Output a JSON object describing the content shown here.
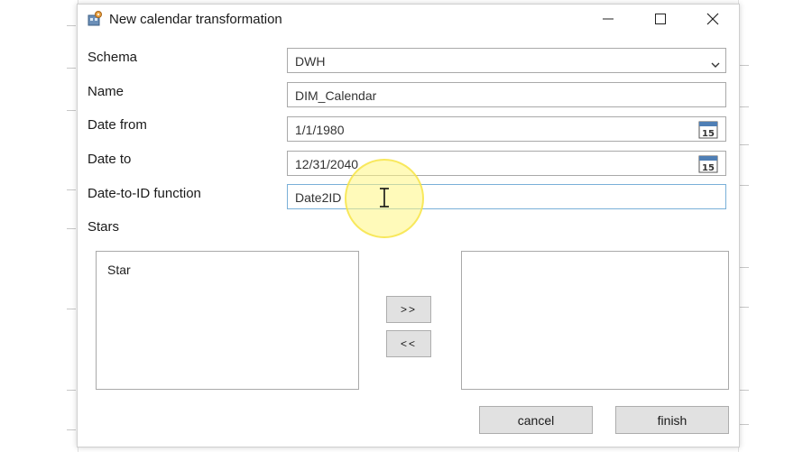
{
  "dialog": {
    "title": "New calendar transformation",
    "app_icon": "calendar-transform-icon"
  },
  "window_controls": {
    "minimize_icon": "minimize-icon",
    "maximize_icon": "maximize-icon",
    "close_icon": "close-icon"
  },
  "form": {
    "schema": {
      "label": "Schema",
      "value": "DWH"
    },
    "name": {
      "label": "Name",
      "value": "DIM_Calendar"
    },
    "date_from": {
      "label": "Date from",
      "value": "1/1/1980",
      "picker_day": "15"
    },
    "date_to": {
      "label": "Date to",
      "value": "12/31/2040",
      "picker_day": "15"
    },
    "date_to_id": {
      "label": "Date-to-ID function",
      "value": "Date2ID"
    },
    "stars_label": "Stars"
  },
  "stars": {
    "available": [
      "Star"
    ],
    "selected": []
  },
  "buttons": {
    "add": ">>",
    "remove": "<<",
    "cancel": "cancel",
    "finish": "finish"
  },
  "colors": {
    "focus_border": "#7ab0d8",
    "button_bg": "#e1e1e1",
    "cursor_highlight": "#fff582"
  }
}
